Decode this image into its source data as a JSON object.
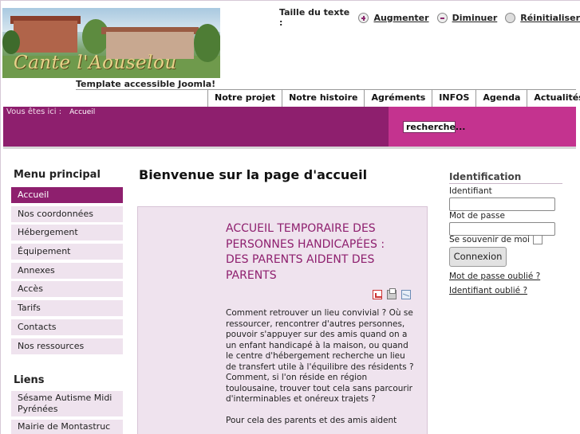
{
  "header": {
    "logo_text": "Cante l'Aouselou",
    "tagline": "Template accessible Joomla!",
    "text_size": {
      "label": "Taille du texte :",
      "increase": "Augmenter",
      "decrease": "Diminuer",
      "reset": "Réinitialiser"
    }
  },
  "topnav": {
    "items": [
      "Notre projet",
      "Notre histoire",
      "Agréments",
      "INFOS",
      "Agenda",
      "Actualités"
    ]
  },
  "breadcrumb": {
    "label": "Vous êtes ici :",
    "current": "Accueil"
  },
  "search": {
    "value": "recherche..."
  },
  "sidebar": {
    "menu_title": "Menu principal",
    "menu_items": [
      "Accueil",
      "Nos coordonnées",
      "Hébergement",
      "Équipement",
      "Annexes",
      "Accès",
      "Tarifs",
      "Contacts",
      "Nos ressources"
    ],
    "active_index": 0,
    "links_title": "Liens",
    "links": [
      "Sésame Autisme Midi Pyrénées",
      "Mairie de Montastruc"
    ]
  },
  "main": {
    "page_title": "Bienvenue sur la page d'accueil",
    "article": {
      "title": "ACCUEIL TEMPORAIRE DES PERSONNES HANDICAPÉES : DES PARENTS AIDENT DES PARENTS",
      "icons": [
        "pdf-icon",
        "print-icon",
        "email-icon"
      ],
      "paragraph1": "Comment retrouver un lieu convivial ? Où se ressourcer, rencontrer d'autres personnes, pouvoir s'appuyer sur des amis quand on a un enfant handicapé à la maison, ou quand le centre d'hébergement recherche un lieu de transfert utile à l'équilibre des résidents ? Comment, si l'on réside en région toulousaine, trouver tout cela sans parcourir d'interminables et onéreux trajets ?",
      "paragraph2": "Pour cela des parents et des amis aident"
    }
  },
  "login": {
    "title": "Identification",
    "username_label": "Identifiant",
    "password_label": "Mot de passe",
    "remember_label": "Se souvenir de moi",
    "submit_label": "Connexion",
    "forgot_password": "Mot de passe oublié ?",
    "forgot_username": "Identifiant oublié ?"
  },
  "colors": {
    "accent": "#8e1f6e",
    "accent_light": "#c4338f",
    "menu_bg": "#efe3ee"
  }
}
